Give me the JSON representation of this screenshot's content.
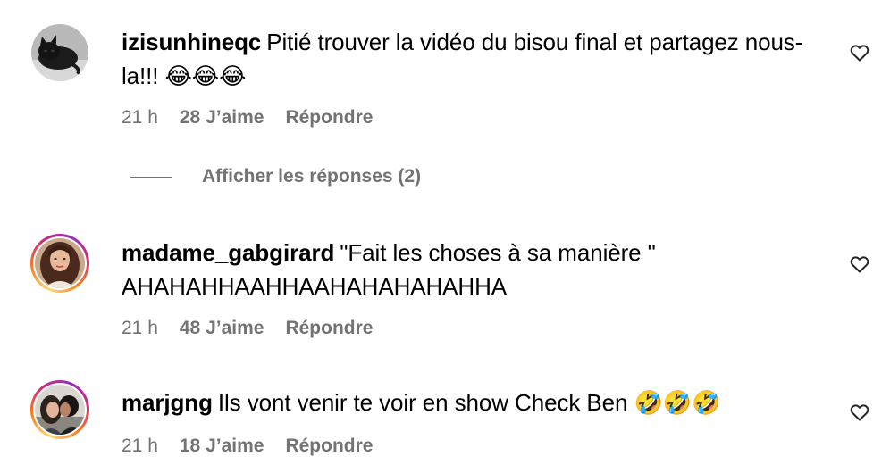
{
  "comments": [
    {
      "username": "izisunhineqc",
      "text": "Pitié trouver la vidéo du bisou final et partagez nous-la!!! 😂😂😂",
      "time": "21 h",
      "likes": "28 J’aime",
      "reply": "Répondre",
      "avatar": "black-cat-avatar",
      "story_ring": false
    },
    {
      "username": "madame_gabgirard",
      "text": "\"Fait les choses à sa manière \" AHAHAHHAAHHAAHAHAHAHAHHA",
      "time": "21 h",
      "likes": "48 J’aime",
      "reply": "Répondre",
      "avatar": "woman-portrait-avatar",
      "story_ring": true
    },
    {
      "username": "marjgng",
      "text": "Ils vont venir te voir en show Check Ben 🤣🤣🤣",
      "time": "21 h",
      "likes": "18 J’aime",
      "reply": "Répondre",
      "avatar": "couple-kiss-avatar",
      "story_ring": true
    }
  ],
  "view_replies": "Afficher les réponses (2)",
  "colors": {
    "secondary_text": "#737373",
    "story_ring_start": "#feda75",
    "story_ring_mid": "#d62976",
    "story_ring_end": "#962fbf"
  }
}
